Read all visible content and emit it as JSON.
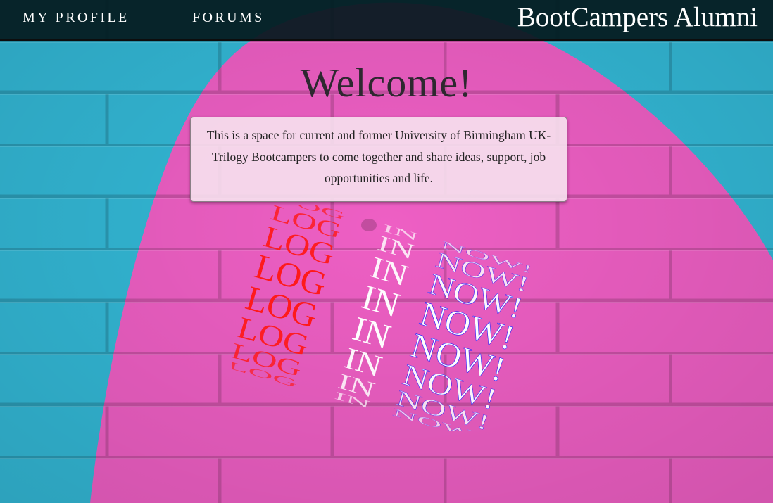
{
  "nav": {
    "profile_label": "MY PROFILE",
    "forums_label": "FORUMS",
    "brand": "BootCampers Alumni"
  },
  "main": {
    "heading": "Welcome!",
    "intro": "This is a space for current and former University of Birmingham UK-Trilogy Bootcampers to come together and share ideas, support, job opportunities and life."
  },
  "login_cta": {
    "words": [
      "LOG",
      "IN",
      "NOW!"
    ]
  },
  "colors": {
    "wall_blue": "#33b8d6",
    "wall_pink": "#ee5fc4",
    "nav_bg": "#04191d",
    "cta_red": "#ff1a1a",
    "cta_white": "#ffffff",
    "cta_blue": "#1a1aff"
  }
}
